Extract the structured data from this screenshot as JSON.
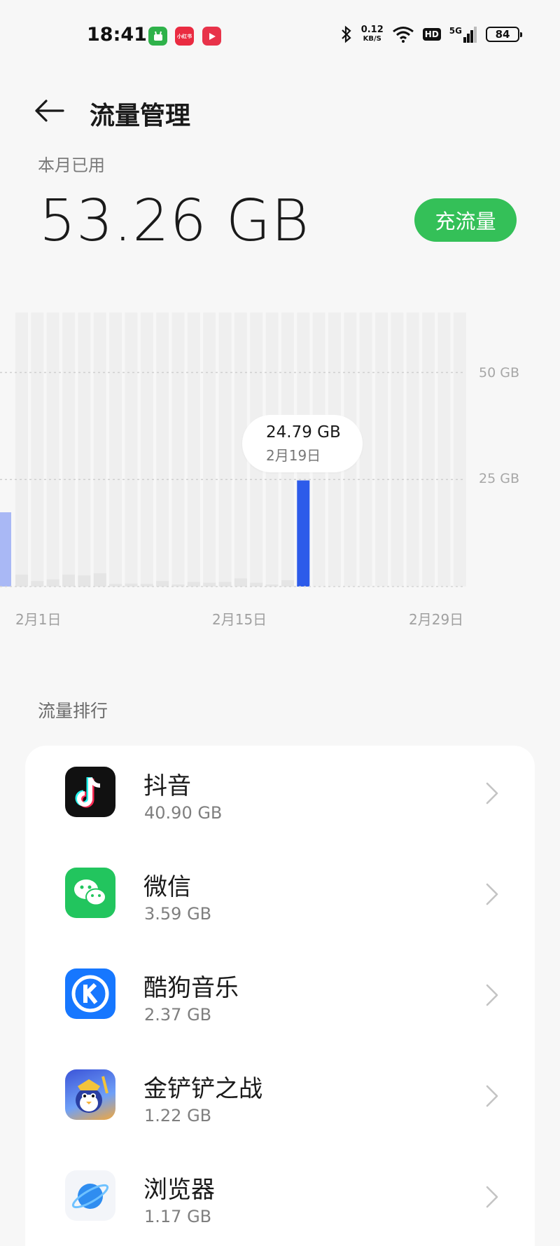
{
  "status_bar": {
    "time": "18:41",
    "app_icons": [
      "game-icon",
      "xiaohongshu-icon",
      "video-icon"
    ],
    "xiaohongshu_text": "小红书",
    "net_speed_value": "0.12",
    "net_speed_unit": "KB/S",
    "hd": "HD",
    "network": "5G",
    "battery": "84"
  },
  "header": {
    "title": "流量管理"
  },
  "summary": {
    "label": "本月已用",
    "value": "53.26 GB",
    "recharge_button": "充流量"
  },
  "chart_data": {
    "type": "bar",
    "y_axis_labels": [
      "50 GB",
      "25 GB"
    ],
    "x_axis_labels": [
      "2月1日",
      "2月15日",
      "2月29日"
    ],
    "ylim": [
      0,
      64
    ],
    "unit": "GB",
    "categories": [
      "1",
      "2",
      "3",
      "4",
      "5",
      "6",
      "7",
      "8",
      "9",
      "10",
      "11",
      "12",
      "13",
      "14",
      "15",
      "16",
      "17",
      "18",
      "19",
      "20",
      "21",
      "22",
      "23",
      "24",
      "25",
      "26",
      "27",
      "28",
      "29"
    ],
    "values": [
      2.8,
      1.3,
      1.7,
      2.8,
      2.6,
      3.1,
      0.6,
      0.7,
      0.6,
      1.3,
      0.4,
      1.1,
      0.9,
      1.1,
      1.9,
      0.9,
      0.4,
      1.5,
      24.79,
      0,
      0,
      0,
      0,
      0,
      0,
      0,
      0,
      0,
      0
    ],
    "selected": {
      "value": "24.79 GB",
      "date": "2月19日"
    },
    "highlight_color": "#2d5bea",
    "edge_bar_color": "#a9b8f5",
    "bar_color": "#e5e5e5",
    "column_bg_color": "#efefef"
  },
  "ranking": {
    "title": "流量排行",
    "apps": [
      {
        "name": "抖音",
        "usage": "40.90 GB",
        "icon": "douyin-icon"
      },
      {
        "name": "微信",
        "usage": "3.59 GB",
        "icon": "wechat-icon"
      },
      {
        "name": "酷狗音乐",
        "usage": "2.37 GB",
        "icon": "kugou-icon"
      },
      {
        "name": "金铲铲之战",
        "usage": "1.22 GB",
        "icon": "jinchanchan-icon"
      },
      {
        "name": "浏览器",
        "usage": "1.17 GB",
        "icon": "browser-icon"
      }
    ]
  }
}
